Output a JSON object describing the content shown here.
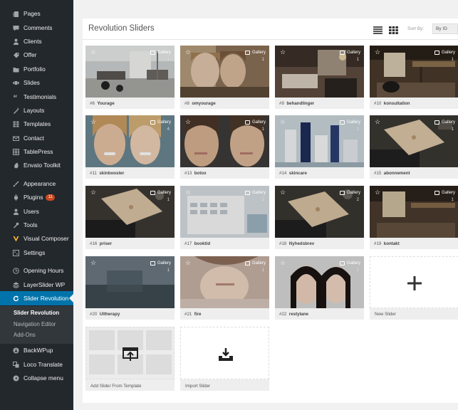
{
  "sidebar": {
    "items": [
      {
        "label": "Pages",
        "icon": "pages-icon"
      },
      {
        "label": "Comments",
        "icon": "comments-icon"
      },
      {
        "label": "Clients",
        "icon": "clients-icon"
      },
      {
        "label": "Offer",
        "icon": "offer-icon"
      },
      {
        "label": "Portfolio",
        "icon": "portfolio-icon"
      },
      {
        "label": "Slides",
        "icon": "slides-icon"
      },
      {
        "label": "Testimonials",
        "icon": "testimonials-icon"
      },
      {
        "label": "Layouts",
        "icon": "layouts-icon"
      },
      {
        "label": "Templates",
        "icon": "templates-icon"
      },
      {
        "label": "Contact",
        "icon": "contact-icon"
      },
      {
        "label": "TablePress",
        "icon": "tablepress-icon"
      },
      {
        "label": "Envato Toolkit",
        "icon": "envato-icon"
      },
      {
        "label": "Appearance",
        "icon": "appearance-icon"
      },
      {
        "label": "Plugins",
        "icon": "plugins-icon",
        "badge": "11"
      },
      {
        "label": "Users",
        "icon": "users-icon"
      },
      {
        "label": "Tools",
        "icon": "tools-icon"
      },
      {
        "label": "Visual Composer",
        "icon": "visual-composer-icon"
      },
      {
        "label": "Settings",
        "icon": "settings-icon"
      },
      {
        "label": "Opening Hours",
        "icon": "clock-icon"
      },
      {
        "label": "LayerSlider WP",
        "icon": "layerslider-icon"
      },
      {
        "label": "Slider Revolution",
        "icon": "refresh-icon",
        "active": true
      },
      {
        "label": "BackWPup",
        "icon": "backwpup-icon"
      },
      {
        "label": "Loco Translate",
        "icon": "loco-translate-icon"
      },
      {
        "label": "Collapse menu",
        "icon": "collapse-icon"
      }
    ],
    "submenu": [
      {
        "label": "Slider Revolution",
        "current": true
      },
      {
        "label": "Navigation Editor"
      },
      {
        "label": "Add-Ons"
      }
    ]
  },
  "panel": {
    "title": "Revolution Sliders",
    "sort_label": "Sort By:",
    "sort_value": "By ID"
  },
  "sliders": [
    {
      "id": "#6",
      "name": "Yourage",
      "type": "Gallery",
      "count": "1"
    },
    {
      "id": "#8",
      "name": "omyourage",
      "type": "Gallery",
      "count": "1"
    },
    {
      "id": "#9",
      "name": "behandlinger",
      "type": "Gallery",
      "count": "1"
    },
    {
      "id": "#10",
      "name": "konsultation",
      "type": "Gallery",
      "count": "1"
    },
    {
      "id": "#11",
      "name": "skinbooster",
      "type": "Gallery",
      "count": "4"
    },
    {
      "id": "#13",
      "name": "botox",
      "type": "Gallery",
      "count": "1"
    },
    {
      "id": "#14",
      "name": "skincare",
      "type": "Gallery",
      "count": "1"
    },
    {
      "id": "#15",
      "name": "abonnement",
      "type": "Gallery",
      "count": "1"
    },
    {
      "id": "#16",
      "name": "priser",
      "type": "Gallery",
      "count": "1"
    },
    {
      "id": "#17",
      "name": "booktid",
      "type": "Gallery",
      "count": "1"
    },
    {
      "id": "#18",
      "name": "Nyhedsbrev",
      "type": "Gallery",
      "count": "2"
    },
    {
      "id": "#19",
      "name": "kontakt",
      "type": "Gallery",
      "count": "1"
    },
    {
      "id": "#20",
      "name": "Ultherapy",
      "type": "Gallery",
      "count": "1"
    },
    {
      "id": "#21",
      "name": "fire",
      "type": "Gallery",
      "count": "1"
    },
    {
      "id": "#22",
      "name": "restylane",
      "type": "Gallery",
      "count": "1"
    }
  ],
  "actions": {
    "new_slider": "New Slider",
    "add_from_template": "Add Slider From Template",
    "import_slider": "Import Slider"
  }
}
